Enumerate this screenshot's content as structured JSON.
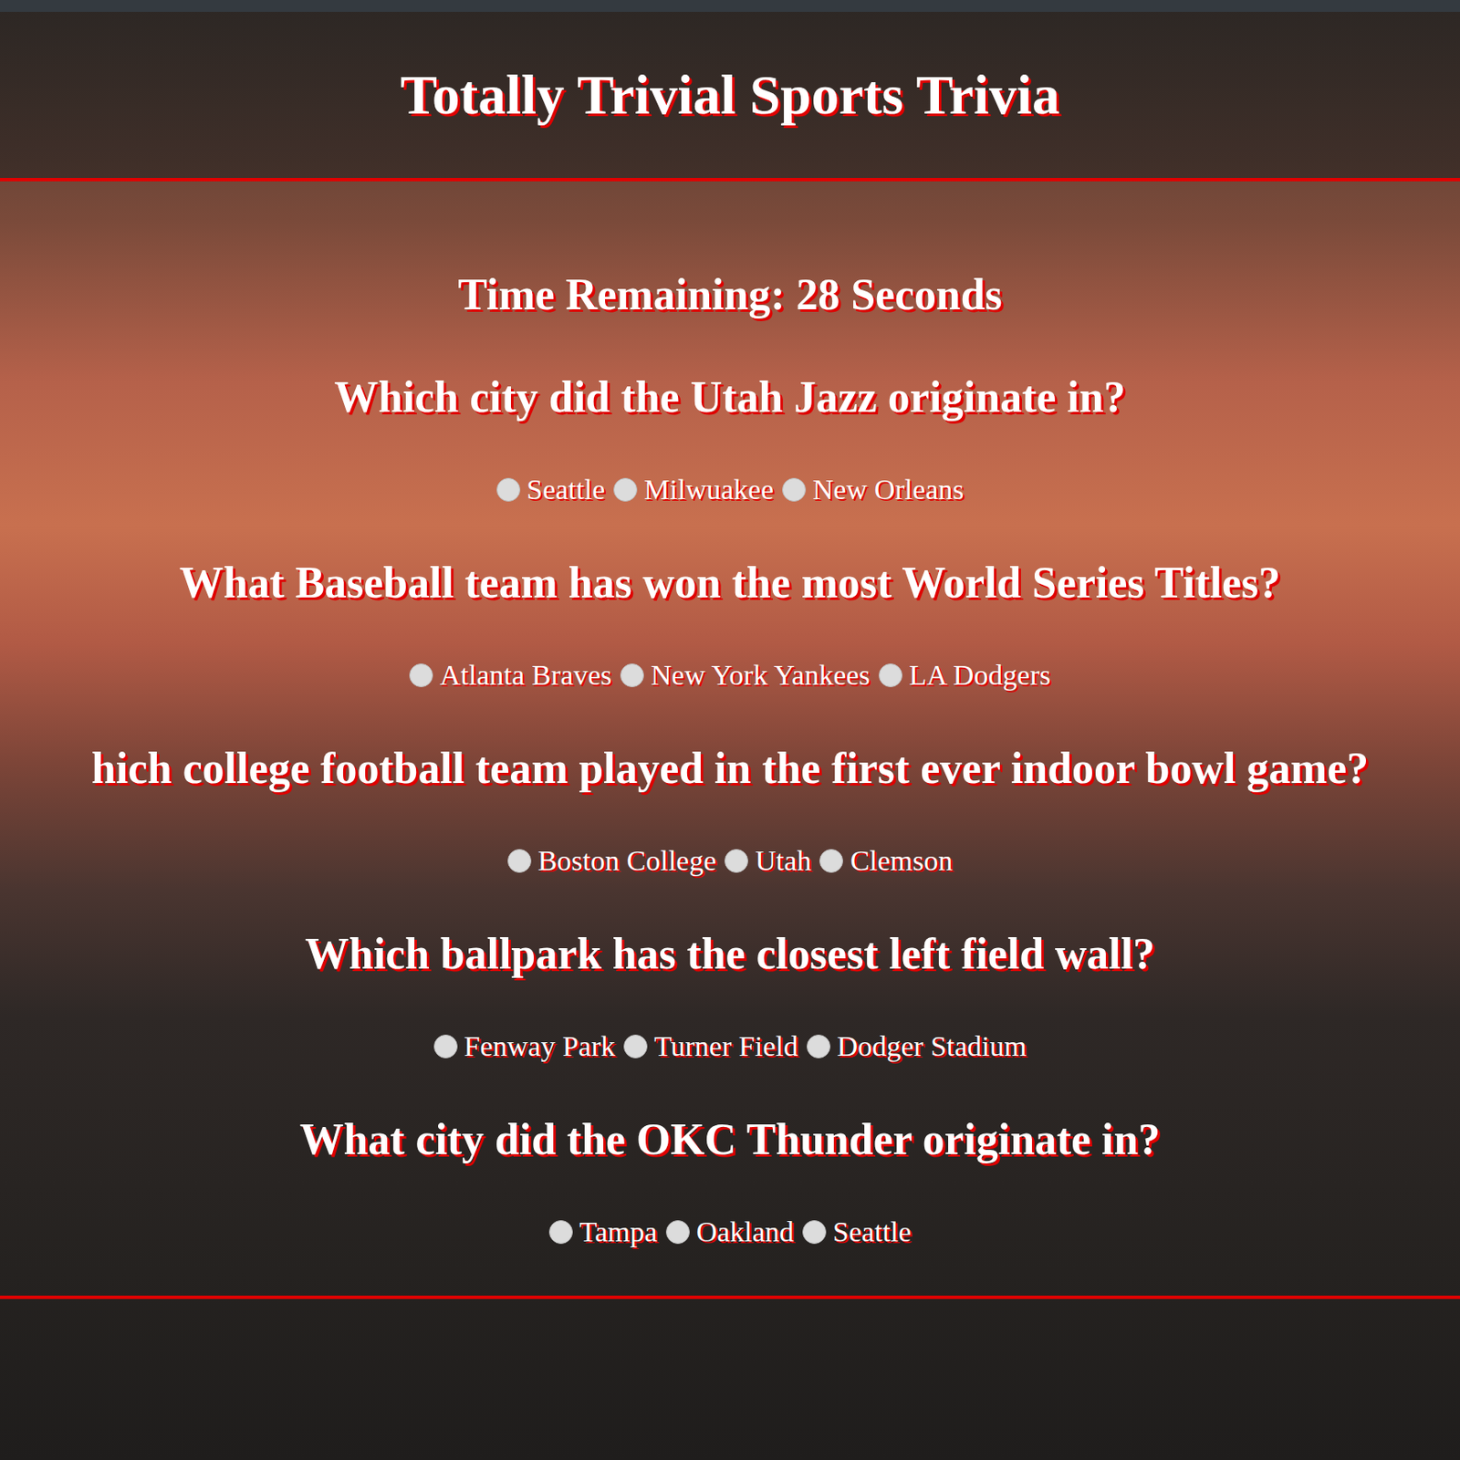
{
  "title": "Totally Trivial Sports Trivia",
  "timer": "Time Remaining: 28 Seconds",
  "questions": [
    {
      "text": "Which city did the Utah Jazz originate in?",
      "options": [
        {
          "label": "Seattle",
          "selected": false
        },
        {
          "label": "Milwuakee",
          "selected": false
        },
        {
          "label": "New Orleans",
          "selected": false
        }
      ]
    },
    {
      "text": "What Baseball team has won the most World Series Titles?",
      "options": [
        {
          "label": "Atlanta Braves",
          "selected": false
        },
        {
          "label": "New York Yankees",
          "selected": false
        },
        {
          "label": "LA Dodgers",
          "selected": false
        }
      ]
    },
    {
      "text": "hich college football team played in the first ever indoor bowl game?",
      "options": [
        {
          "label": "Boston College",
          "selected": false
        },
        {
          "label": "Utah",
          "selected": false
        },
        {
          "label": "Clemson",
          "selected": false
        }
      ]
    },
    {
      "text": "Which ballpark has the closest left field wall?",
      "options": [
        {
          "label": "Fenway Park",
          "selected": false
        },
        {
          "label": "Turner Field",
          "selected": false
        },
        {
          "label": "Dodger Stadium",
          "selected": false
        }
      ]
    },
    {
      "text": "What city did the OKC Thunder originate in?",
      "options": [
        {
          "label": "Tampa",
          "selected": false
        },
        {
          "label": "Oakland",
          "selected": false
        },
        {
          "label": "Seattle",
          "selected": false
        }
      ]
    }
  ]
}
